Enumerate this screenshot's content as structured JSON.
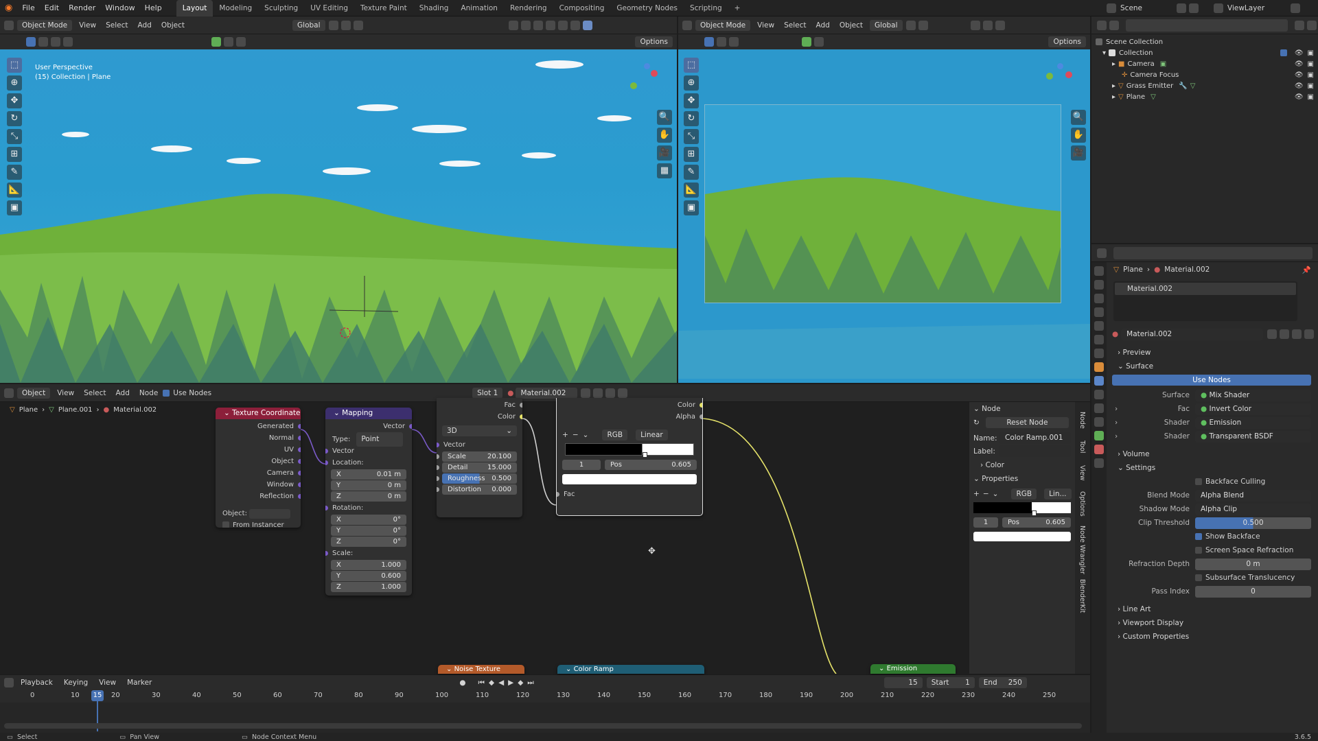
{
  "menu": [
    "File",
    "Edit",
    "Render",
    "Window",
    "Help"
  ],
  "workspaces": [
    "Layout",
    "Modeling",
    "Sculpting",
    "UV Editing",
    "Texture Paint",
    "Shading",
    "Animation",
    "Rendering",
    "Compositing",
    "Geometry Nodes",
    "Scripting"
  ],
  "scene": "Scene",
  "viewlayer": "ViewLayer",
  "vp_left": {
    "mode": "Object Mode",
    "menus": [
      "View",
      "Select",
      "Add",
      "Object"
    ],
    "orient": "Global",
    "options": "Options",
    "title": "User Perspective",
    "subtitle": "(15) Collection | Plane"
  },
  "vp_right": {
    "mode": "Object Mode",
    "menus": [
      "View",
      "Select",
      "Add",
      "Object"
    ],
    "orient": "Global",
    "options": "Options"
  },
  "outliner": {
    "root": "Scene Collection",
    "collection": "Collection",
    "items": [
      "Camera",
      "Camera Focus",
      "Grass Emitter",
      "Plane"
    ]
  },
  "node_editor": {
    "type": "Object",
    "menus": [
      "View",
      "Select",
      "Add",
      "Node"
    ],
    "use_nodes": "Use Nodes",
    "slot": "Slot 1",
    "material": "Material.002",
    "breadcrumb": [
      "Plane",
      "Plane.001",
      "Material.002"
    ]
  },
  "tex_coord": {
    "title": "Texture Coordinate",
    "outputs": [
      "Generated",
      "Normal",
      "UV",
      "Object",
      "Camera",
      "Window",
      "Reflection"
    ],
    "object_label": "Object:",
    "from_instancer": "From Instancer"
  },
  "mapping": {
    "title": "Mapping",
    "vector_out": "Vector",
    "type_label": "Type:",
    "type": "Point",
    "vector_in": "Vector",
    "location": "Location:",
    "loc": [
      [
        "X",
        "0.01 m"
      ],
      [
        "Y",
        "0 m"
      ],
      [
        "Z",
        "0 m"
      ]
    ],
    "rotation": "Rotation:",
    "rot": [
      [
        "X",
        "0°"
      ],
      [
        "Y",
        "0°"
      ],
      [
        "Z",
        "0°"
      ]
    ],
    "scale": "Scale:",
    "scl": [
      [
        "X",
        "1.000"
      ],
      [
        "Y",
        "0.600"
      ],
      [
        "Z",
        "1.000"
      ]
    ]
  },
  "noise": {
    "out_fac": "Fac",
    "out_color": "Color",
    "dim": "3D",
    "vector": "Vector",
    "fields": [
      [
        "Scale",
        "20.100"
      ],
      [
        "Detail",
        "15.000"
      ],
      [
        "Roughness",
        "0.500"
      ],
      [
        "Distortion",
        "0.000"
      ]
    ],
    "title": "Noise Texture"
  },
  "ramp": {
    "out_color": "Color",
    "out_alpha": "Alpha",
    "mode": "RGB",
    "interp": "Linear",
    "index": "1",
    "pos_label": "Pos",
    "pos": "0.605",
    "fac": "Fac",
    "title": "Color Ramp"
  },
  "emission": {
    "title": "Emission"
  },
  "nside": {
    "header": "Node",
    "reset": "Reset Node",
    "name_label": "Name:",
    "name": "Color Ramp.001",
    "label_label": "Label:",
    "color": "Color",
    "properties": "Properties",
    "mode": "RGB",
    "interp": "Lin...",
    "index": "1",
    "pos_label": "Pos",
    "pos": "0.605",
    "tabs": [
      "Node",
      "Tool",
      "View",
      "Options",
      "Node Wrangler",
      "BlenderKit"
    ]
  },
  "props": {
    "crumb": [
      "Plane",
      "Material.002"
    ],
    "slot": "Material.002",
    "mat": "Material.002",
    "preview": "Preview",
    "surface": "Surface",
    "use_nodes": "Use Nodes",
    "rows": [
      [
        "Surface",
        "Mix Shader"
      ],
      [
        "Fac",
        "Invert Color"
      ],
      [
        "Shader",
        "Emission"
      ],
      [
        "Shader",
        "Transparent BSDF"
      ]
    ],
    "volume": "Volume",
    "settings": "Settings",
    "backface": "Backface Culling",
    "blend_label": "Blend Mode",
    "blend": "Alpha Blend",
    "shadow_label": "Shadow Mode",
    "shadow": "Alpha Clip",
    "clip_label": "Clip Threshold",
    "clip": "0.500",
    "show_backface": "Show Backface",
    "ssr": "Screen Space Refraction",
    "refr_label": "Refraction Depth",
    "refr": "0 m",
    "sss": "Subsurface Translucency",
    "pass_label": "Pass Index",
    "pass": "0",
    "lineart": "Line Art",
    "viewport": "Viewport Display",
    "custom": "Custom Properties"
  },
  "timeline": {
    "menus": [
      "Playback",
      "Keying",
      "View",
      "Marker"
    ],
    "frame": "15",
    "start_label": "Start",
    "start": "1",
    "end_label": "End",
    "end": "250",
    "ticks": [
      "0",
      "10",
      "20",
      "30",
      "40",
      "50",
      "60",
      "70",
      "80",
      "90",
      "100",
      "110",
      "120",
      "130",
      "140",
      "150",
      "160",
      "170",
      "180",
      "190",
      "200",
      "210",
      "220",
      "230",
      "240",
      "250"
    ],
    "cur": "15"
  },
  "status": {
    "select": "Select",
    "pan": "Pan View",
    "ctx": "Node Context Menu",
    "version": "3.6.5"
  },
  "colors": {
    "accent": "#4772b3",
    "tex": "#8c1f3a",
    "vector": "#3c2f6e",
    "color": "#cc9a2a",
    "shader": "#2f7a2f",
    "ramp": "#1f5e75"
  }
}
